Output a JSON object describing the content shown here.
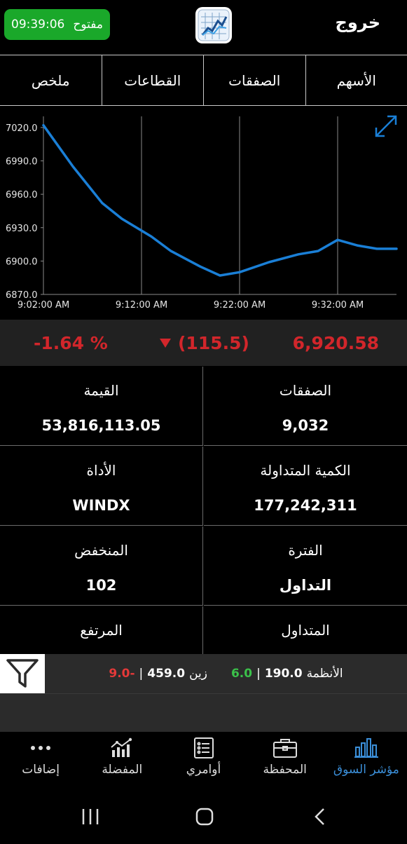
{
  "header": {
    "exit_label": "خروج",
    "status_label": "مفتوح",
    "time": "09:39:06"
  },
  "tabs": [
    {
      "label": "الأسهم"
    },
    {
      "label": "الصفقات"
    },
    {
      "label": "القطاعات"
    },
    {
      "label": "ملخص"
    }
  ],
  "chart_data": {
    "type": "line",
    "title": "",
    "xlabel": "",
    "ylabel": "",
    "x": [
      "9:02:00 AM",
      "9:05:00 AM",
      "9:08:00 AM",
      "9:10:00 AM",
      "9:13:00 AM",
      "9:15:00 AM",
      "9:18:00 AM",
      "9:20:00 AM",
      "9:22:00 AM",
      "9:25:00 AM",
      "9:28:00 AM",
      "9:30:00 AM",
      "9:32:00 AM",
      "9:34:00 AM",
      "9:36:00 AM",
      "9:38:00 AM"
    ],
    "y": [
      7022,
      6985,
      6952,
      6938,
      6922,
      6909,
      6895,
      6887,
      6890,
      6899,
      6906,
      6909,
      6919,
      6914,
      6911,
      6911
    ],
    "ylim": [
      6870,
      7030
    ],
    "yticks": [
      "7020.0",
      "6990.0",
      "6960.0",
      "6930.0",
      "6900.0",
      "6870.0"
    ],
    "xticks": [
      "9:02:00 AM",
      "9:12:00 AM",
      "9:22:00 AM",
      "9:32:00 AM"
    ],
    "grid": true,
    "line_color": "#1a7fd6"
  },
  "summary": {
    "value": "6,920.58",
    "change": "(115.5)",
    "percent": "-1.64 %",
    "color": "#d2262b"
  },
  "stats": [
    {
      "label": "الصفقات",
      "value": "9,032"
    },
    {
      "label": "القيمة",
      "value": "53,816,113.05"
    },
    {
      "label": "الكمية المتداولة",
      "value": "177,242,311"
    },
    {
      "label": "الأداة",
      "value": "WINDX"
    },
    {
      "label": "الفترة",
      "value": "التداول"
    },
    {
      "label": "المنخفض",
      "value": "102"
    },
    {
      "label": "المتداول",
      "value": ""
    },
    {
      "label": "المرتفع",
      "value": ""
    }
  ],
  "ticker": {
    "item1_name": "الأنظمة",
    "item1_price": "190.0",
    "item1_change": "6.0",
    "item2_name": "زين",
    "item2_price": "459.0",
    "item2_change": "-9.0"
  },
  "bottom_nav": [
    {
      "label": "مؤشر السوق",
      "icon": "bar-chart-icon",
      "active": true
    },
    {
      "label": "المحفظة",
      "icon": "briefcase-icon",
      "active": false
    },
    {
      "label": "أوامري",
      "icon": "list-icon",
      "active": false
    },
    {
      "label": "المفضلة",
      "icon": "trend-chart-icon",
      "active": false
    },
    {
      "label": "إضافات",
      "icon": "more-icon",
      "active": false
    }
  ],
  "colors": {
    "accent": "#3b8fd9",
    "status_green": "#1aa82a",
    "negative": "#d2262b",
    "positive": "#3bc14a"
  }
}
